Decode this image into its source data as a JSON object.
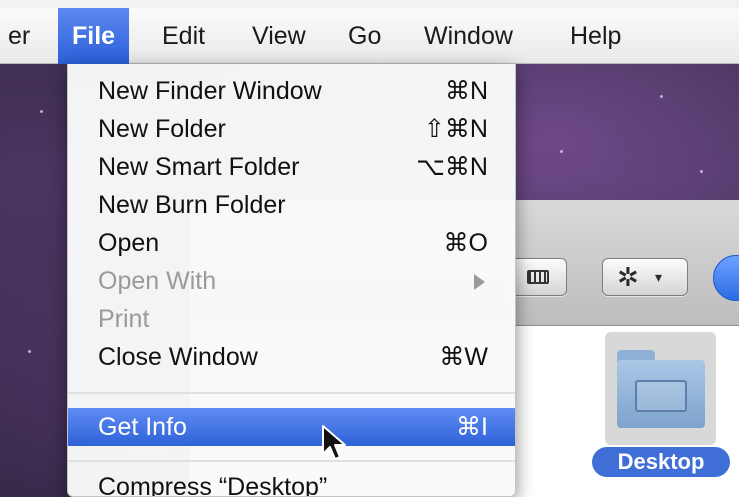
{
  "menubar": {
    "items": [
      {
        "label": "er"
      },
      {
        "label": "File"
      },
      {
        "label": "Edit"
      },
      {
        "label": "View"
      },
      {
        "label": "Go"
      },
      {
        "label": "Window"
      },
      {
        "label": "Help"
      }
    ]
  },
  "file_menu": {
    "items": [
      {
        "label": "New Finder Window",
        "shortcut": "⌘N"
      },
      {
        "label": "New Folder",
        "shortcut": "⇧⌘N"
      },
      {
        "label": "New Smart Folder",
        "shortcut": "⌥⌘N"
      },
      {
        "label": "New Burn Folder",
        "shortcut": ""
      },
      {
        "label": "Open",
        "shortcut": "⌘O"
      },
      {
        "label": "Open With",
        "shortcut": ""
      },
      {
        "label": "Print",
        "shortcut": ""
      },
      {
        "label": "Close Window",
        "shortcut": "⌘W"
      },
      {
        "label": "Get Info",
        "shortcut": "⌘I"
      },
      {
        "label": "Compress “Desktop”",
        "shortcut": ""
      }
    ]
  },
  "toolbar": {
    "gear_glyph": "✲",
    "chevron_glyph": "▾",
    "help_glyph": "?"
  },
  "desktop": {
    "folder_label": "Desktop"
  },
  "colors": {
    "accent": "#2f62d8",
    "menubar": "#efefef",
    "disabled_text": "#9a9a9a"
  }
}
